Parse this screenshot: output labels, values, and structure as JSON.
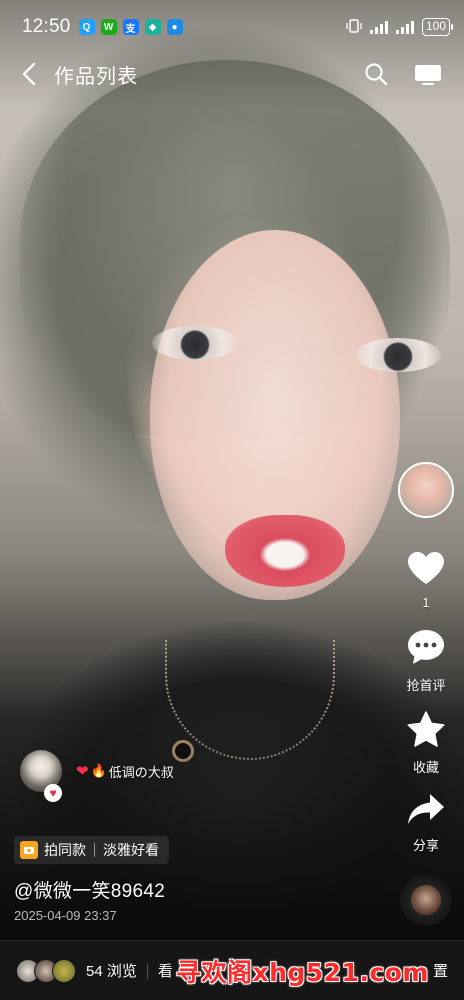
{
  "status_bar": {
    "time": "12:50",
    "apps": [
      {
        "icon": "qq-icon",
        "color": "#20a0ff",
        "glyph": "Q"
      },
      {
        "icon": "wechat-icon",
        "color": "#1aad19",
        "glyph": "W"
      },
      {
        "icon": "alipay-icon",
        "color": "#1677ff",
        "glyph": "支"
      },
      {
        "icon": "shield-app-icon",
        "color": "#19b39a",
        "glyph": "◆"
      },
      {
        "icon": "browser-app-icon",
        "color": "#1e88e5",
        "glyph": "●"
      }
    ],
    "battery": "100"
  },
  "nav": {
    "title": "作品列表"
  },
  "rail": {
    "like_count": "1",
    "comment_label": "抢首评",
    "collect_label": "收藏",
    "share_label": "分享"
  },
  "hot": {
    "text": "低调の大叔"
  },
  "tag": {
    "primary": "拍同款",
    "secondary": "淡雅好看"
  },
  "post": {
    "author": "@微微一笑89642",
    "date": "2025-04-09 23:37"
  },
  "bottom": {
    "views": "54 浏览",
    "look": "看",
    "watermark": "寻欢阁xhg521.com",
    "settings": "置"
  },
  "colors": {
    "like_heart": "#ffffff",
    "accent_red": "#ff2d4b",
    "watermark": "#ff2a2a"
  }
}
